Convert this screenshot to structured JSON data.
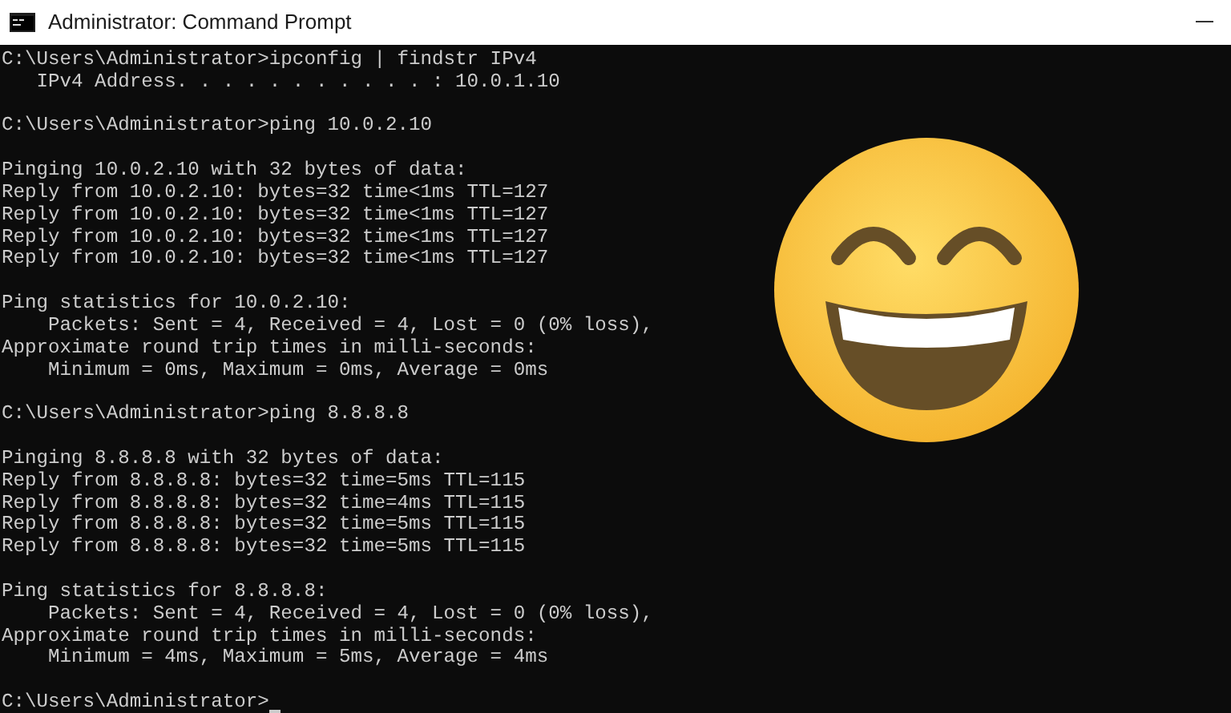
{
  "window": {
    "title": "Administrator: Command Prompt"
  },
  "console": {
    "blocks": [
      [
        "C:\\Users\\Administrator>ipconfig | findstr IPv4",
        "   IPv4 Address. . . . . . . . . . . : 10.0.1.10"
      ],
      [
        "C:\\Users\\Administrator>ping 10.0.2.10"
      ],
      [
        "Pinging 10.0.2.10 with 32 bytes of data:",
        "Reply from 10.0.2.10: bytes=32 time<1ms TTL=127",
        "Reply from 10.0.2.10: bytes=32 time<1ms TTL=127",
        "Reply from 10.0.2.10: bytes=32 time<1ms TTL=127",
        "Reply from 10.0.2.10: bytes=32 time<1ms TTL=127"
      ],
      [
        "Ping statistics for 10.0.2.10:",
        "    Packets: Sent = 4, Received = 4, Lost = 0 (0% loss),",
        "Approximate round trip times in milli-seconds:",
        "    Minimum = 0ms, Maximum = 0ms, Average = 0ms"
      ],
      [
        "C:\\Users\\Administrator>ping 8.8.8.8"
      ],
      [
        "Pinging 8.8.8.8 with 32 bytes of data:",
        "Reply from 8.8.8.8: bytes=32 time=5ms TTL=115",
        "Reply from 8.8.8.8: bytes=32 time=4ms TTL=115",
        "Reply from 8.8.8.8: bytes=32 time=5ms TTL=115",
        "Reply from 8.8.8.8: bytes=32 time=5ms TTL=115"
      ],
      [
        "Ping statistics for 8.8.8.8:",
        "    Packets: Sent = 4, Received = 4, Lost = 0 (0% loss),",
        "Approximate round trip times in milli-seconds:",
        "    Minimum = 4ms, Maximum = 5ms, Average = 4ms"
      ]
    ],
    "prompt": {
      "text": "C:\\Users\\Administrator>",
      "cursor": true
    }
  }
}
